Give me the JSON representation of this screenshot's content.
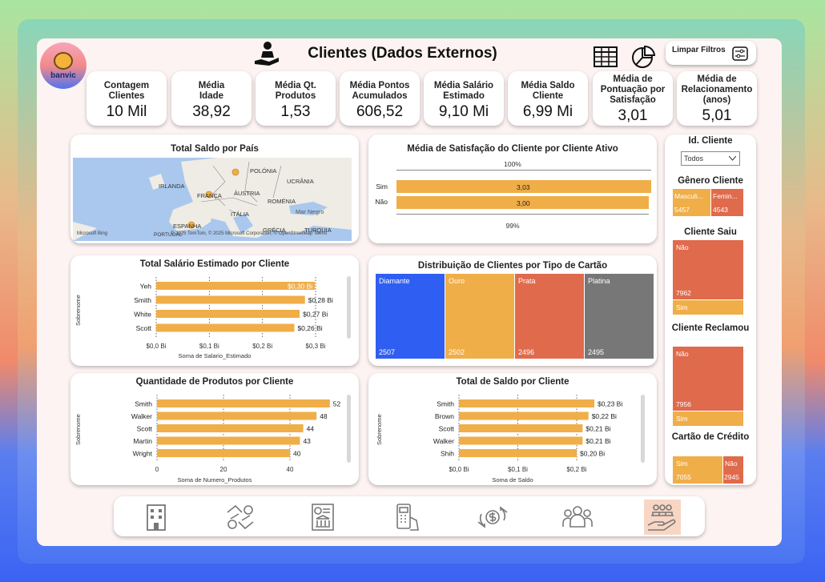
{
  "header": {
    "logo_text": "banvic",
    "title": "Clientes (Dados Externos)",
    "clear_filters_label": "Limpar Filtros"
  },
  "kpis": [
    {
      "label": "Contagem Clientes",
      "value": "10 Mil"
    },
    {
      "label": "Média Idade",
      "value": "38,92"
    },
    {
      "label": "Média Qt. Produtos",
      "value": "1,53"
    },
    {
      "label": "Média Pontos Acumulados",
      "value": "606,52"
    },
    {
      "label": "Média Salário Estimado",
      "value": "9,10 Mi"
    },
    {
      "label": "Média Saldo Cliente",
      "value": "6,99 Mi"
    },
    {
      "label": "Média de Pontuação por Satisfação",
      "value": "3,01"
    },
    {
      "label": "Média de Relacionamento (anos)",
      "value": "5,01"
    }
  ],
  "map": {
    "title": "Total Saldo por País",
    "labels": [
      "IRLANDA",
      "POLÓNIA",
      "UCRÂNIA",
      "FRANÇA",
      "ÁUSTRIA",
      "ROMÉNIA",
      "ITÁLIA",
      "Mar Negro",
      "ESPANHA",
      "GRÉCIA",
      "TURQUIA",
      "PORTUGAL"
    ],
    "brand": "Microsoft Bing",
    "attribution": "© 2025 TomTom, © 2025 Microsoft Corporation, © OpenStreetMap  Terms"
  },
  "charts": {
    "satisfaction": {
      "title": "Média de Satisfação do Cliente por Cliente Ativo",
      "top_label": "100%",
      "bottom_label": "99%",
      "rows": [
        {
          "cat": "Sim",
          "value": "3,03"
        },
        {
          "cat": "Não",
          "value": "3,00"
        }
      ]
    },
    "salary": {
      "title": "Total Salário Estimado por Cliente",
      "ylabel": "Sobrenome",
      "xlabel": "Soma de Salario_Estimado",
      "ticks": [
        "$0,0 Bi",
        "$0,1 Bi",
        "$0,2 Bi",
        "$0,3 Bi"
      ]
    },
    "cards": {
      "title": "Distribuição de Clientes por Tipo de Cartão",
      "items": [
        {
          "name": "Diamante",
          "value": "2507",
          "color": "#2f5ff2"
        },
        {
          "name": "Ouro",
          "value": "2502",
          "color": "#f0ae48"
        },
        {
          "name": "Prata",
          "value": "2496",
          "color": "#e06a4c"
        },
        {
          "name": "Platina",
          "value": "2495",
          "color": "#777777"
        }
      ]
    },
    "products": {
      "title": "Quantidade de Produtos por Cliente",
      "ylabel": "Sobrenome",
      "xlabel": "Soma de Numero_Produtos",
      "ticks": [
        "0",
        "20",
        "40"
      ]
    },
    "balance": {
      "title": "Total de Saldo por Cliente",
      "ylabel": "Sobrenome",
      "xlabel": "Soma de Saldo",
      "ticks": [
        "$0,0 Bi",
        "$0,1 Bi",
        "$0,2 Bi"
      ]
    }
  },
  "chart_data": [
    {
      "type": "bar",
      "title": "Total Salário Estimado por Cliente",
      "xlabel": "Soma de Salario_Estimado",
      "ylabel": "Sobrenome",
      "categories": [
        "Yeh",
        "Smith",
        "White",
        "Scott"
      ],
      "values": [
        0.3,
        0.28,
        0.27,
        0.26
      ],
      "labels": [
        "$0,30 Bi",
        "$0,28 Bi",
        "$0,27 Bi",
        "$0,26 Bi"
      ],
      "xlim": [
        0,
        0.3
      ]
    },
    {
      "type": "bar",
      "title": "Quantidade de Produtos por Cliente",
      "xlabel": "Soma de Numero_Produtos",
      "ylabel": "Sobrenome",
      "categories": [
        "Smith",
        "Walker",
        "Scott",
        "Martin",
        "Wright"
      ],
      "values": [
        52,
        48,
        44,
        43,
        40
      ],
      "labels": [
        "52",
        "48",
        "44",
        "43",
        "40"
      ],
      "xlim": [
        0,
        40
      ]
    },
    {
      "type": "bar",
      "title": "Total de Saldo por Cliente",
      "xlabel": "Soma de Saldo",
      "ylabel": "Sobrenome",
      "categories": [
        "Smith",
        "Brown",
        "Scott",
        "Walker",
        "Shih"
      ],
      "values": [
        0.23,
        0.22,
        0.21,
        0.21,
        0.2
      ],
      "labels": [
        "$0,23 Bi",
        "$0,22 Bi",
        "$0,21 Bi",
        "$0,21 Bi",
        "$0,20 Bi"
      ],
      "xlim": [
        0,
        0.2
      ]
    },
    {
      "type": "bar",
      "title": "Média de Satisfação do Cliente por Cliente Ativo",
      "categories": [
        "Sim",
        "Não"
      ],
      "values": [
        3.03,
        3.0
      ]
    }
  ],
  "filters": {
    "client_id": {
      "title": "Id. Cliente",
      "selected": "Todos"
    },
    "gender": {
      "title": "Gênero Cliente",
      "items": [
        {
          "name": "Masculi...",
          "value": "5457",
          "color": "#f0ae48"
        },
        {
          "name": "Femin...",
          "value": "4543",
          "color": "#e06a4c"
        }
      ]
    },
    "left": {
      "title": "Cliente Saiu",
      "items": [
        {
          "name": "Não",
          "value": "7962",
          "color": "#e06a4c"
        },
        {
          "name": "Sim",
          "value": "",
          "color": "#f0ae48"
        }
      ]
    },
    "complained": {
      "title": "Cliente Reclamou",
      "items": [
        {
          "name": "Não",
          "value": "7956",
          "color": "#e06a4c"
        },
        {
          "name": "Sim",
          "value": "",
          "color": "#f0ae48"
        }
      ]
    },
    "credit": {
      "title": "Cartão de Crédito",
      "items": [
        {
          "name": "Sim",
          "value": "7055",
          "color": "#f0ae48"
        },
        {
          "name": "Não",
          "value": "2945",
          "color": "#e06a4c"
        }
      ]
    }
  },
  "nav": [
    "building-icon",
    "exchange-money-icon",
    "bank-document-icon",
    "card-payment-icon",
    "dollar-transfer-icon",
    "group-icon",
    "clients-hand-icon"
  ],
  "colors": {
    "bar": "#f0ae48",
    "accent_red": "#e06a4c",
    "accent_blue": "#2f5ff2",
    "active_nav": "#f8d6c4"
  }
}
